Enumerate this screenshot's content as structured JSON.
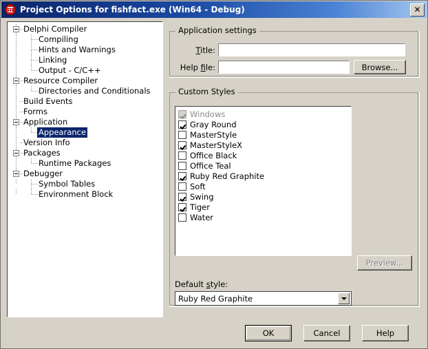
{
  "window": {
    "title": "Project Options for fishfact.exe  (Win64 - Debug)",
    "icon": "delphi-app-icon",
    "close_label": "✕",
    "titlebar_color": "#0a246a",
    "dialog_background": "#d6d2c8"
  },
  "tree": {
    "items": [
      {
        "label": "Delphi Compiler",
        "level": 0,
        "expander": "minus",
        "selected": false
      },
      {
        "label": "Compiling",
        "level": 1,
        "expander": "none",
        "selected": false
      },
      {
        "label": "Hints and Warnings",
        "level": 1,
        "expander": "none",
        "selected": false
      },
      {
        "label": "Linking",
        "level": 1,
        "expander": "none",
        "selected": false
      },
      {
        "label": "Output - C/C++",
        "level": 1,
        "expander": "none",
        "selected": false
      },
      {
        "label": "Resource Compiler",
        "level": 0,
        "expander": "minus",
        "selected": false
      },
      {
        "label": "Directories and Conditionals",
        "level": 1,
        "expander": "none",
        "selected": false
      },
      {
        "label": "Build Events",
        "level": 0,
        "expander": "none",
        "selected": false
      },
      {
        "label": "Forms",
        "level": 0,
        "expander": "none",
        "selected": false
      },
      {
        "label": "Application",
        "level": 0,
        "expander": "minus",
        "selected": false
      },
      {
        "label": "Appearance",
        "level": 1,
        "expander": "none",
        "selected": true
      },
      {
        "label": "Version Info",
        "level": 0,
        "expander": "none",
        "selected": false
      },
      {
        "label": "Packages",
        "level": 0,
        "expander": "minus",
        "selected": false
      },
      {
        "label": "Runtime Packages",
        "level": 1,
        "expander": "none",
        "selected": false
      },
      {
        "label": "Debugger",
        "level": 0,
        "expander": "minus",
        "selected": false
      },
      {
        "label": "Symbol Tables",
        "level": 1,
        "expander": "none",
        "selected": false
      },
      {
        "label": "Environment Block",
        "level": 1,
        "expander": "none",
        "selected": false
      }
    ]
  },
  "app_settings": {
    "group_title": "Application settings",
    "title_label": "Title:",
    "title_label_accel": "T",
    "title_value": "",
    "title_placeholder": "",
    "helpfile_label": "Help file:",
    "helpfile_label_accel": "f",
    "helpfile_value": "",
    "helpfile_placeholder": "",
    "browse_label": "Browse..."
  },
  "custom_styles": {
    "group_title": "Custom Styles",
    "items": [
      {
        "label": "Windows",
        "checked": true,
        "enabled": false
      },
      {
        "label": "Gray Round",
        "checked": true,
        "enabled": true
      },
      {
        "label": "MasterStyle",
        "checked": false,
        "enabled": true
      },
      {
        "label": "MasterStyleX",
        "checked": true,
        "enabled": true
      },
      {
        "label": "Office Black",
        "checked": false,
        "enabled": true
      },
      {
        "label": "Office Teal",
        "checked": false,
        "enabled": true
      },
      {
        "label": "Ruby Red Graphite",
        "checked": true,
        "enabled": true
      },
      {
        "label": "Soft",
        "checked": false,
        "enabled": true
      },
      {
        "label": "Swing",
        "checked": true,
        "enabled": true
      },
      {
        "label": "Tiger",
        "checked": true,
        "enabled": true
      },
      {
        "label": "Water",
        "checked": false,
        "enabled": true
      }
    ],
    "preview_label": "Preview...",
    "preview_enabled": false,
    "default_style_label": "Default style:",
    "default_style_label_accel": "s",
    "default_style_value": "Ruby Red Graphite",
    "default_style_options": [
      "Windows",
      "Gray Round",
      "MasterStyle",
      "MasterStyleX",
      "Office Black",
      "Office Teal",
      "Ruby Red Graphite",
      "Soft",
      "Swing",
      "Tiger",
      "Water"
    ]
  },
  "footer": {
    "ok_label": "OK",
    "cancel_label": "Cancel",
    "help_label": "Help",
    "default_button": "OK"
  }
}
